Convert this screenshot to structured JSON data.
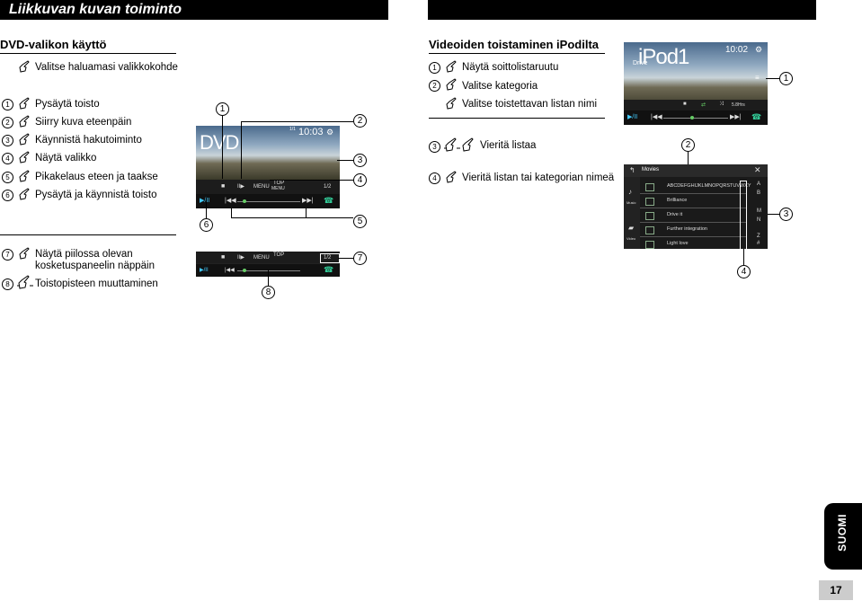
{
  "header": {
    "left_title": "Liikkuvan kuvan toiminto",
    "right_title": ""
  },
  "left_section": {
    "title": "DVD-valikon käyttö",
    "select_item": "Valitse haluamasi valikkokohde",
    "items": [
      {
        "num": "1",
        "text": "Pysäytä toisto"
      },
      {
        "num": "2",
        "text": "Siirry kuva eteenpäin"
      },
      {
        "num": "3",
        "text": "Käynnistä hakutoiminto"
      },
      {
        "num": "4",
        "text": "Näytä valikko"
      },
      {
        "num": "5",
        "text": "Pikakelaus eteen ja taakse"
      },
      {
        "num": "6",
        "text": "Pysäytä ja käynnistä toisto"
      }
    ],
    "hidden_items": [
      {
        "num": "7",
        "text_line1": "Näytä piilossa olevan",
        "text_line2": "kosketuspaneelin näppäin"
      },
      {
        "num": "8",
        "text": "Toistopisteen muuttaminen"
      }
    ]
  },
  "dvd_screen": {
    "label": "DVD",
    "time": "10:03",
    "small_date": "1/1",
    "menu": "MENU",
    "top_menu_line1": "TOP",
    "top_menu_line2": "MENU",
    "chapter": "1/2",
    "callouts": [
      "1",
      "2",
      "3",
      "4",
      "5",
      "6",
      "7",
      "8"
    ]
  },
  "right_section": {
    "title": "Videoiden toistaminen iPodilta",
    "items": [
      {
        "num": "1",
        "text": "Näytä soittolistaruutu"
      },
      {
        "num": "2",
        "text": "Valitse kategoria"
      },
      {
        "num": "",
        "text": "Valitse toistettavan listan nimi"
      },
      {
        "num": "3",
        "text": "Vieritä listaa"
      },
      {
        "num": "4",
        "text": "Vieritä listan tai kategorian nimeä"
      }
    ]
  },
  "ipod_screen": {
    "label": "iPod1",
    "sub_label": "Drive",
    "time": "10:02",
    "speed": "5.8Hrs",
    "callouts": [
      "1",
      "2",
      "3",
      "4"
    ]
  },
  "list_screen": {
    "header": "Movies",
    "side_labels": [
      "Music",
      "Video"
    ],
    "rows": [
      "ABCDEFGHIJKLMNOPQRSTUVWXY",
      "Brilliance",
      "Drive it",
      "Further integration",
      "Light love"
    ],
    "alpha": [
      "A",
      "B",
      "M",
      "N",
      "Z",
      "#"
    ]
  },
  "side_tab": "SUOMI",
  "page_number": "17"
}
